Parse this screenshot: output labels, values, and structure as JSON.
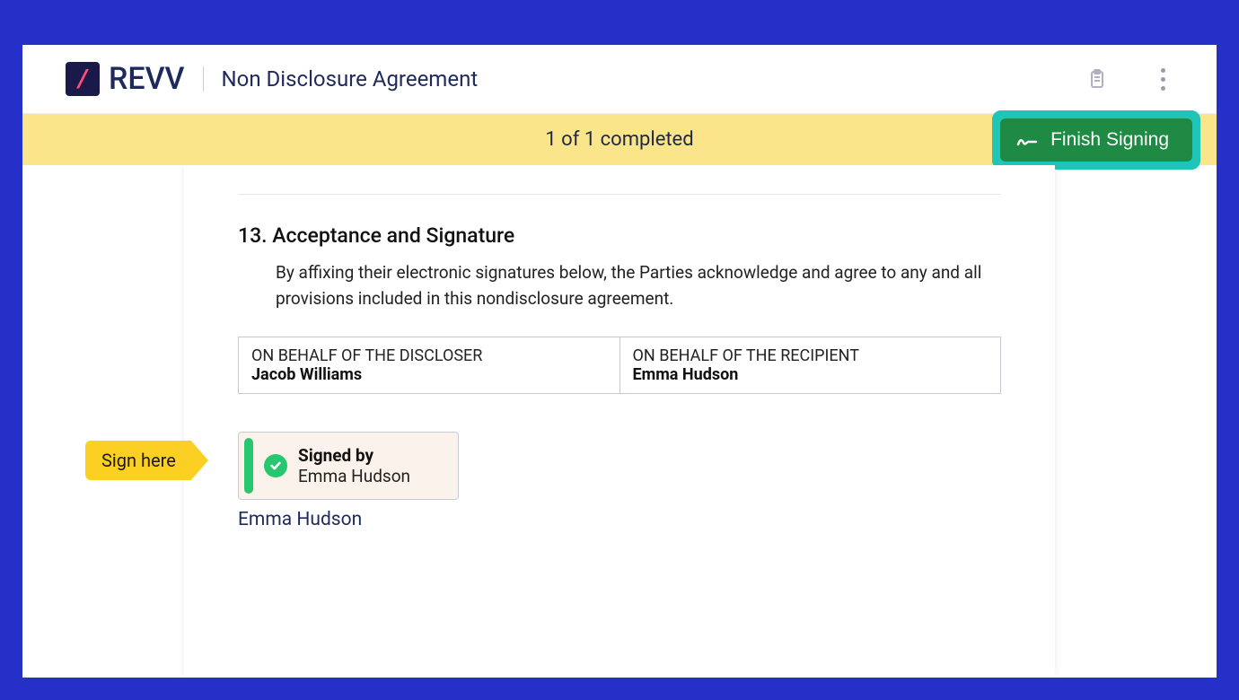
{
  "header": {
    "brand": "REVV",
    "doc_title": "Non Disclosure Agreement"
  },
  "status": {
    "text": "1 of 1 completed",
    "finish_label": "Finish Signing"
  },
  "section": {
    "number_title": "13. Acceptance and Signature",
    "body": "By affixing their electronic signatures below, the Parties acknowledge and agree to any and all provisions included in this nondisclosure agreement."
  },
  "parties": {
    "discloser_role": "ON BEHALF OF THE DISCLOSER",
    "discloser_name": "Jacob Williams",
    "recipient_role": "ON BEHALF OF THE RECIPIENT",
    "recipient_name": "Emma Hudson"
  },
  "sign_flag": "Sign here",
  "signed": {
    "label": "Signed by",
    "name": "Emma Hudson"
  },
  "signer_caption": "Emma Hudson"
}
